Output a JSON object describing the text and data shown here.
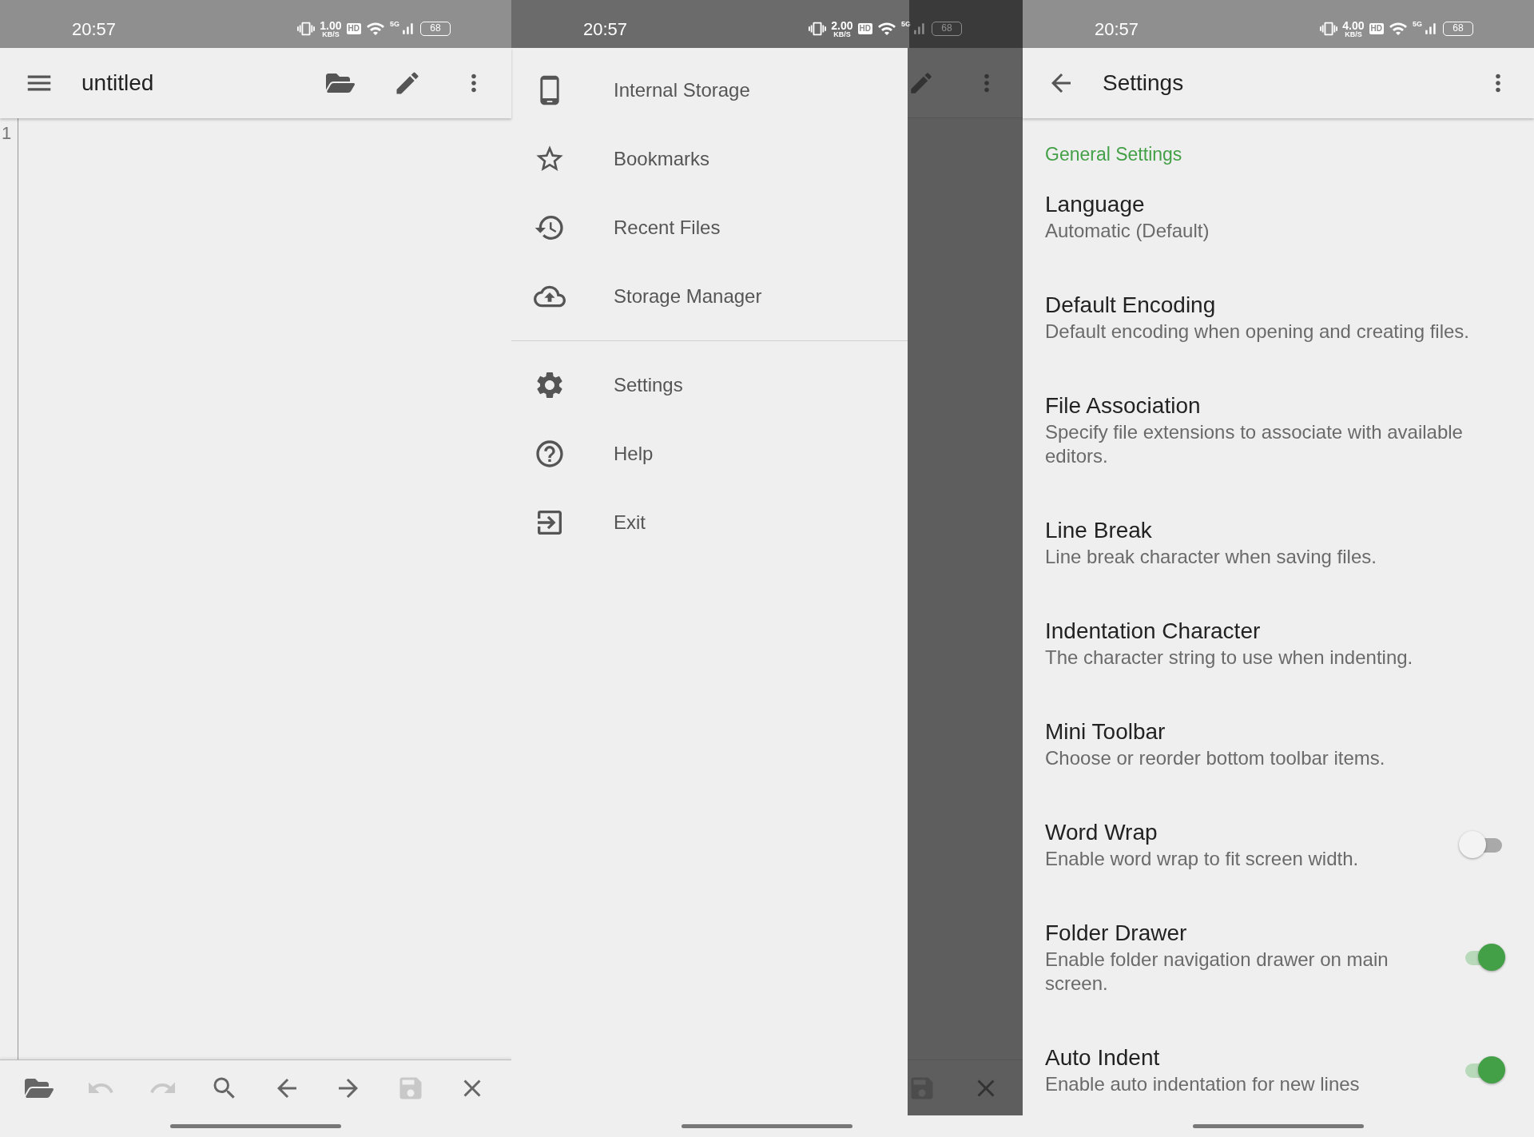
{
  "editor_screen": {
    "status_bar": {
      "time": "20:57",
      "speed": "1.00",
      "speed_unit": "KB/S",
      "hd": "HD",
      "network": "5G",
      "battery": "68"
    },
    "app_bar": {
      "title": "untitled",
      "actions": [
        {
          "kind": "open"
        },
        {
          "kind": "edit"
        },
        {
          "kind": "more"
        }
      ]
    },
    "line_numbers": [
      "1"
    ],
    "toolbar": [
      {
        "kind": "open",
        "disabled": false
      },
      {
        "kind": "undo",
        "disabled": true
      },
      {
        "kind": "redo",
        "disabled": true
      },
      {
        "kind": "search",
        "disabled": false
      },
      {
        "kind": "back",
        "disabled": false
      },
      {
        "kind": "forward",
        "disabled": false
      },
      {
        "kind": "save",
        "disabled": true
      },
      {
        "kind": "close",
        "disabled": false
      }
    ]
  },
  "drawer_screen": {
    "status_bar": {
      "time": "20:57",
      "speed": "2.00",
      "speed_unit": "KB/S",
      "hd": "HD",
      "network": "5G",
      "battery": "68"
    },
    "groups": [
      [
        {
          "kind": "phone",
          "label": "Internal Storage"
        },
        {
          "kind": "star",
          "label": "Bookmarks"
        },
        {
          "kind": "history",
          "label": "Recent Files"
        },
        {
          "kind": "cloud",
          "label": "Storage Manager"
        }
      ],
      [
        {
          "kind": "settings",
          "label": "Settings"
        },
        {
          "kind": "help",
          "label": "Help"
        },
        {
          "kind": "exit",
          "label": "Exit"
        }
      ]
    ],
    "behind_actions": [
      {
        "kind": "edit"
      },
      {
        "kind": "more"
      }
    ],
    "behind_toolbar": [
      {
        "kind": "save"
      },
      {
        "kind": "close"
      }
    ]
  },
  "settings_screen": {
    "status_bar": {
      "time": "20:57",
      "speed": "4.00",
      "speed_unit": "KB/S",
      "hd": "HD",
      "network": "5G",
      "battery": "68"
    },
    "title": "Settings",
    "section": "General Settings",
    "items": [
      {
        "title": "Language",
        "summary": "Automatic (Default)"
      },
      {
        "title": "Default Encoding",
        "summary": "Default encoding when opening and creating files."
      },
      {
        "title": "File Association",
        "summary": "Specify file extensions to associate with available editors."
      },
      {
        "title": "Line Break",
        "summary": "Line break character when saving files."
      },
      {
        "title": "Indentation Character",
        "summary": "The character string to use when indenting."
      },
      {
        "title": "Mini Toolbar",
        "summary": "Choose or reorder bottom toolbar items."
      },
      {
        "title": "Word Wrap",
        "summary": "Enable word wrap to fit screen width.",
        "kind": "switch",
        "on": false
      },
      {
        "title": "Folder Drawer",
        "summary": "Enable folder navigation drawer on main screen.",
        "kind": "switch",
        "on": true
      },
      {
        "title": "Auto Indent",
        "summary": "Enable auto indentation for new lines",
        "kind": "switch",
        "on": true
      }
    ]
  }
}
